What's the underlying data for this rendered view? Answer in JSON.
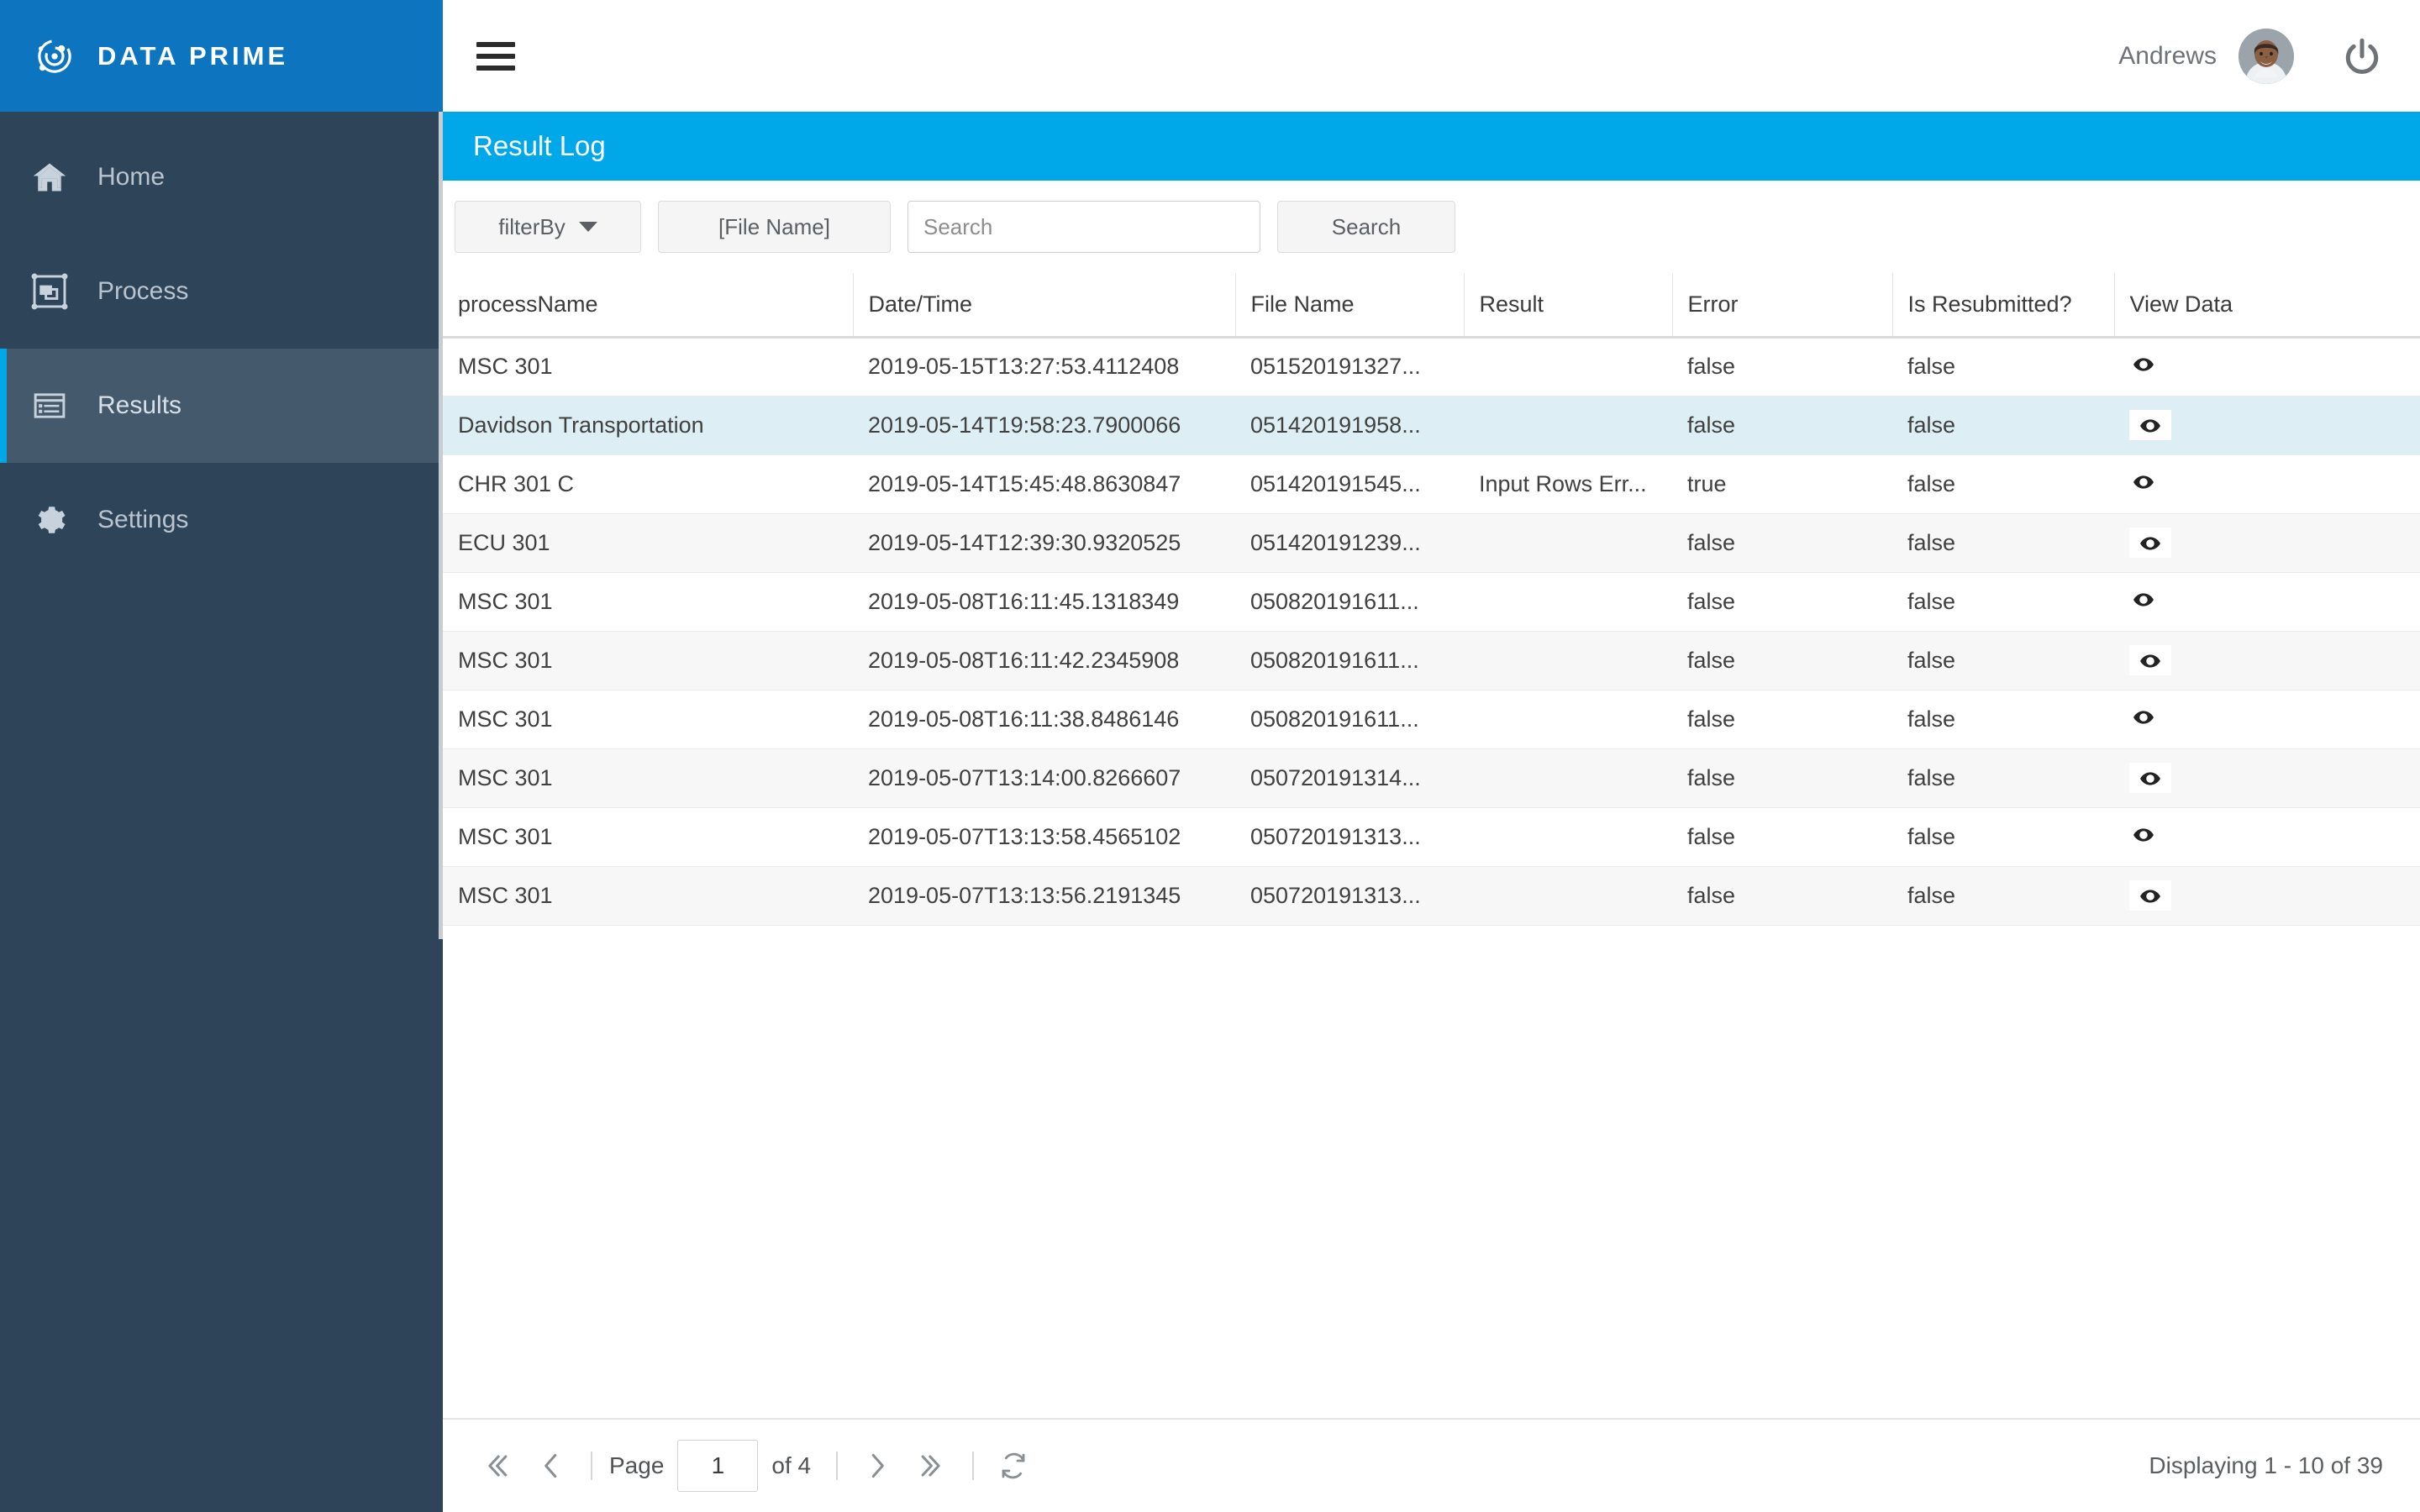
{
  "brand": {
    "name": "DATA PRIME",
    "logo_icon": "orbit-target-icon",
    "color": "#0d75bf"
  },
  "sidebar": {
    "accent_color": "#00a8e8",
    "background": "#2e4459",
    "items": [
      {
        "label": "Home",
        "icon": "home-icon",
        "active": false
      },
      {
        "label": "Process",
        "icon": "process-group-icon",
        "active": false
      },
      {
        "label": "Results",
        "icon": "list-table-icon",
        "active": true
      },
      {
        "label": "Settings",
        "icon": "gear-icon",
        "active": false
      }
    ]
  },
  "topbar": {
    "menu_icon": "hamburger-icon",
    "user_name": "Andrews",
    "avatar_icon": "user-avatar-photo",
    "power_icon": "power-icon"
  },
  "page": {
    "title": "Result Log",
    "title_bar_color": "#00a8ea"
  },
  "toolbar": {
    "filter_label": "filterBy",
    "filter_caret_icon": "chevron-down-icon",
    "file_name_label": "[File Name]",
    "search_value": "",
    "search_placeholder": "Search",
    "search_button_label": "Search"
  },
  "table": {
    "columns": [
      "processName",
      "Date/Time",
      "File Name",
      "Result",
      "Error",
      "Is Resubmitted?",
      "View Data"
    ],
    "view_data_icon": "eye-icon",
    "rows": [
      {
        "processName": "MSC 301",
        "datetime": "2019-05-15T13:27:53.4112408",
        "file_name": "051520191327...",
        "result": "",
        "error": "false",
        "is_resubmitted": "false",
        "highlighted": false
      },
      {
        "processName": "Davidson Transportation",
        "datetime": "2019-05-14T19:58:23.7900066",
        "file_name": "051420191958...",
        "result": "",
        "error": "false",
        "is_resubmitted": "false",
        "highlighted": true
      },
      {
        "processName": "CHR 301 C",
        "datetime": "2019-05-14T15:45:48.8630847",
        "file_name": "051420191545...",
        "result": "Input Rows Err...",
        "error": "true",
        "is_resubmitted": "false",
        "highlighted": false
      },
      {
        "processName": "ECU 301",
        "datetime": "2019-05-14T12:39:30.9320525",
        "file_name": "051420191239...",
        "result": "",
        "error": "false",
        "is_resubmitted": "false",
        "highlighted": false
      },
      {
        "processName": "MSC 301",
        "datetime": "2019-05-08T16:11:45.1318349",
        "file_name": "050820191611...",
        "result": "",
        "error": "false",
        "is_resubmitted": "false",
        "highlighted": false
      },
      {
        "processName": "MSC 301",
        "datetime": "2019-05-08T16:11:42.2345908",
        "file_name": "050820191611...",
        "result": "",
        "error": "false",
        "is_resubmitted": "false",
        "highlighted": false
      },
      {
        "processName": "MSC 301",
        "datetime": "2019-05-08T16:11:38.8486146",
        "file_name": "050820191611...",
        "result": "",
        "error": "false",
        "is_resubmitted": "false",
        "highlighted": false
      },
      {
        "processName": "MSC 301",
        "datetime": "2019-05-07T13:14:00.8266607",
        "file_name": "050720191314...",
        "result": "",
        "error": "false",
        "is_resubmitted": "false",
        "highlighted": false
      },
      {
        "processName": "MSC 301",
        "datetime": "2019-05-07T13:13:58.4565102",
        "file_name": "050720191313...",
        "result": "",
        "error": "false",
        "is_resubmitted": "false",
        "highlighted": false
      },
      {
        "processName": "MSC 301",
        "datetime": "2019-05-07T13:13:56.2191345",
        "file_name": "050720191313...",
        "result": "",
        "error": "false",
        "is_resubmitted": "false",
        "highlighted": false
      }
    ]
  },
  "footer": {
    "first_icon": "double-chevron-left-icon",
    "prev_icon": "chevron-left-icon",
    "page_label": "Page",
    "page_value": "1",
    "of_label": "of 4",
    "next_icon": "chevron-right-icon",
    "last_icon": "double-chevron-right-icon",
    "refresh_icon": "refresh-icon",
    "displaying": "Displaying 1 - 10 of 39"
  }
}
